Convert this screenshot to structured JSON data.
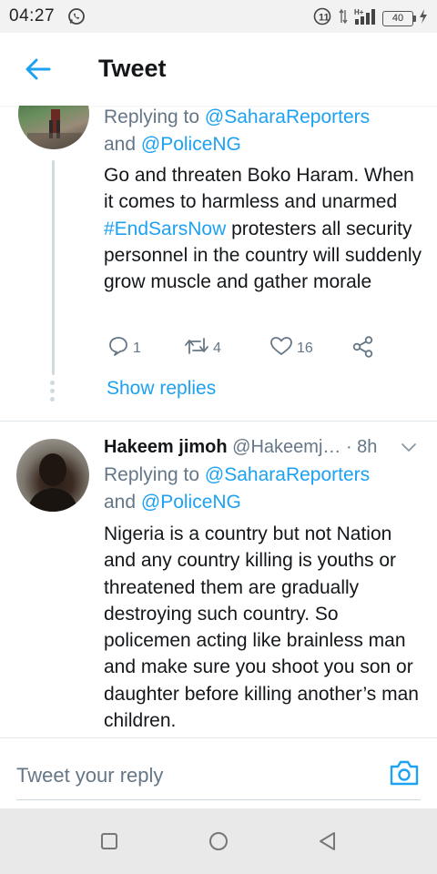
{
  "status_bar": {
    "time": "04:27",
    "battery": "40",
    "network": "H+",
    "sim": "1"
  },
  "app_bar": {
    "title": "Tweet"
  },
  "tweet1": {
    "replying_prefix": "Replying to ",
    "mention1": "@SaharaReporters",
    "conjunction": "and ",
    "mention2": "@PoliceNG",
    "text_before_tag": "Go and threaten Boko Haram. When it comes to harmless and unarmed ",
    "hashtag": "#EndSarsNow",
    "text_after_tag": " protesters all security personnel in the country will suddenly grow muscle and gather morale",
    "reply_count": "1",
    "retweet_count": "4",
    "like_count": "16",
    "show_replies": "Show replies"
  },
  "tweet2": {
    "name": "Hakeem jimoh",
    "handle": "@Hakeemj…",
    "time_sep": " · ",
    "time": "8h",
    "replying_prefix": "Replying to ",
    "mention1": "@SaharaReporters",
    "conjunction": "and ",
    "mention2": "@PoliceNG",
    "text": "Nigeria is a country but not Nation and any country killing is youths or threatened them are gradually destroying such country. So policemen acting like brainless man and make sure you shoot you son or daughter before killing another’s man children."
  },
  "reply_bar": {
    "placeholder": "Tweet your reply"
  },
  "colors": {
    "accent": "#1da1f2",
    "secondary_text": "#657786",
    "primary_text": "#14171a"
  },
  "icons": {
    "back": "arrow-left-icon",
    "reply": "comment-bubble-icon",
    "retweet": "retweet-icon",
    "like": "heart-icon",
    "share": "share-icon",
    "camera": "camera-icon",
    "more": "chevron-down-icon"
  }
}
